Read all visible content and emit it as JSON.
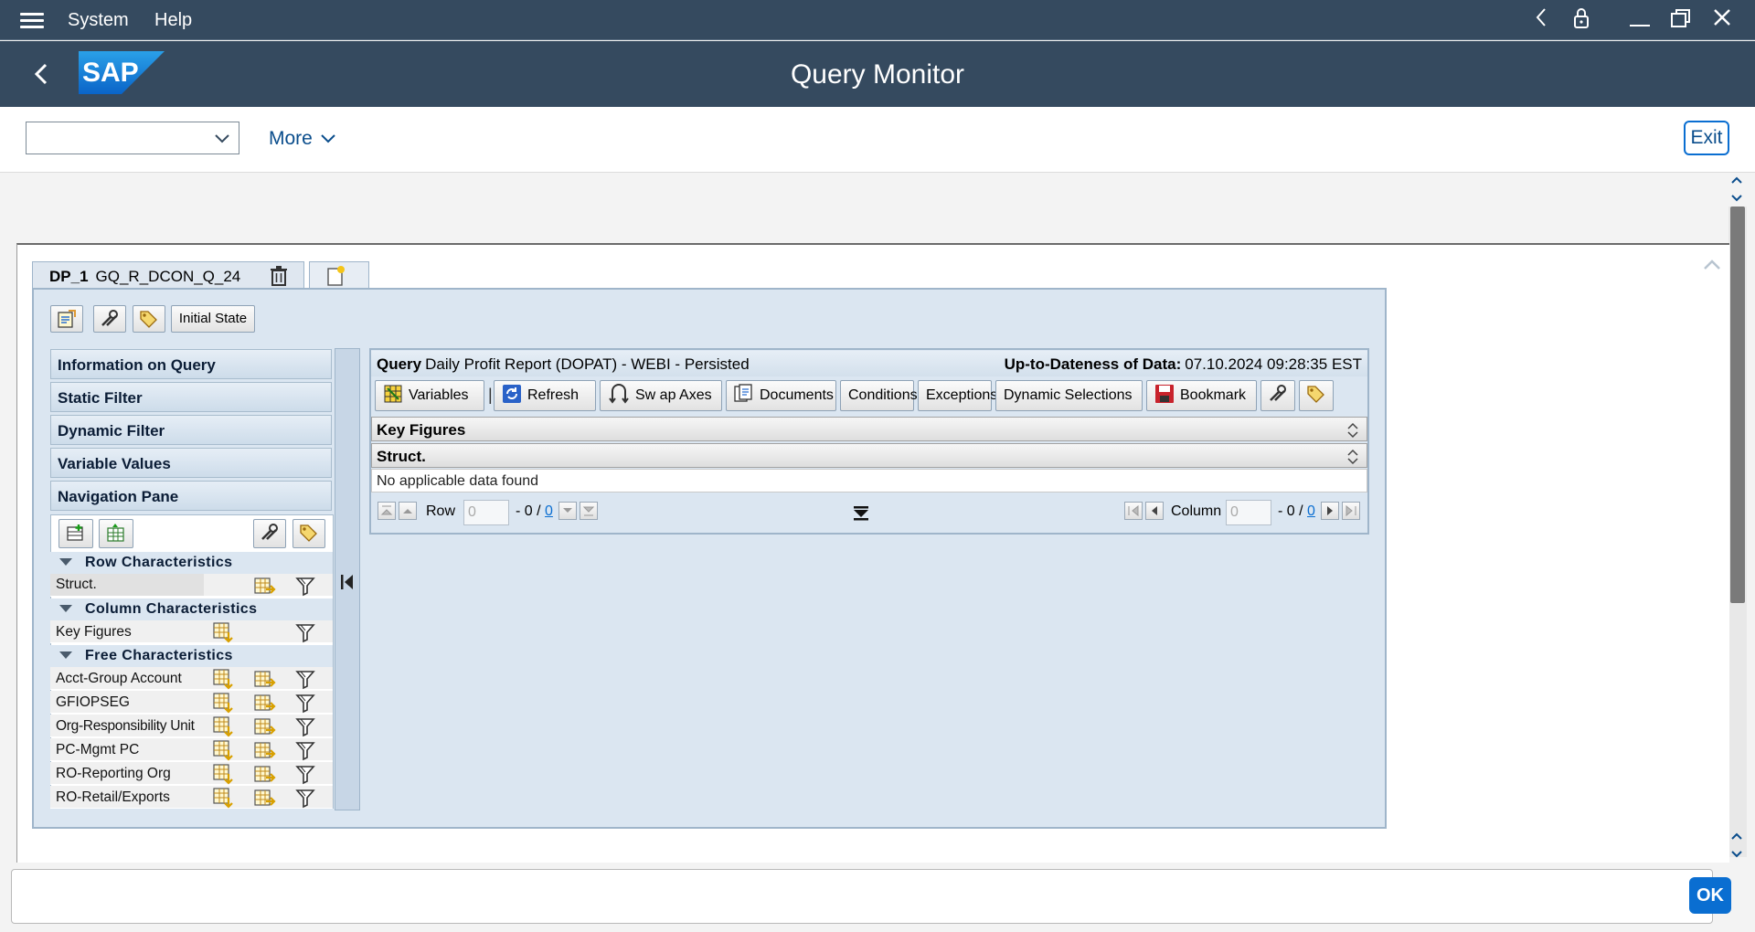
{
  "system_menu": {
    "system": "System",
    "help": "Help"
  },
  "header": {
    "title": "Query Monitor",
    "logo_text": "SAP"
  },
  "toolbar": {
    "dropdown_value": "",
    "more_label": "More",
    "exit_label": "Exit"
  },
  "tab": {
    "dp_label": "DP_1",
    "query_name": "GQ_R_DCON_Q_24"
  },
  "panel_toolbar": {
    "initial_state_label": "Initial State"
  },
  "accordion": [
    "Information on Query",
    "Static Filter",
    "Dynamic Filter",
    "Variable Values",
    "Navigation Pane"
  ],
  "nav": {
    "row_section": "Row Characteristics",
    "column_section": "Column Characteristics",
    "free_section": "Free Characteristics",
    "row_items": [
      "Struct."
    ],
    "column_items": [
      "Key Figures"
    ],
    "free_items": [
      "Acct-Group Account",
      "GFIOPSEG",
      "Org-Responsibility Unit",
      "PC-Mgmt PC",
      "RO-Reporting Org",
      "RO-Retail/Exports"
    ]
  },
  "query": {
    "label": "Query",
    "name": "Daily Profit Report (DOPAT) - WEBI - Persisted",
    "uptodate_label": "Up-to-Dateness of Data:",
    "uptodate_value": "07.10.2024 09:28:35 EST"
  },
  "query_buttons": {
    "variables": "Variables",
    "refresh": "Refresh",
    "swap_axes": "Sw ap Axes",
    "documents": "Documents",
    "conditions": "Conditions",
    "exceptions": "Exceptions",
    "dynamic_selections": "Dynamic Selections",
    "bookmark": "Bookmark"
  },
  "grid": {
    "row1": "Key Figures",
    "row2": "Struct.",
    "empty_message": "No applicable data found"
  },
  "pager": {
    "row_label": "Row",
    "row_value": "0",
    "row_count_prefix": "- 0 /",
    "row_total": "0",
    "column_label": "Column",
    "column_value": "0",
    "column_count_prefix": "- 0 /",
    "column_total": "0"
  },
  "command": {
    "ok_label": "OK",
    "value": ""
  },
  "colors": {
    "shell": "#354a5f",
    "panel": "#dbe6f1",
    "accent": "#0a6ed1"
  }
}
